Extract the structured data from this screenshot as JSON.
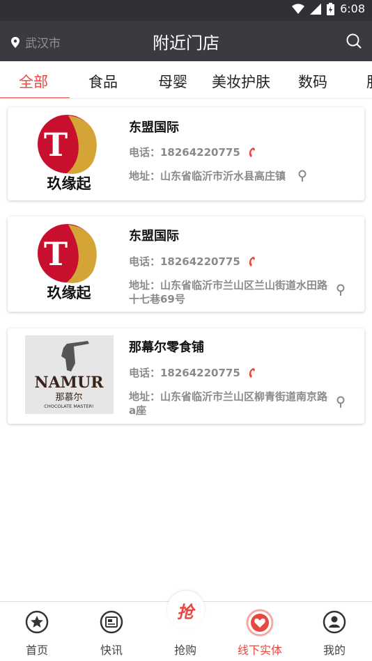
{
  "status": {
    "time": "6:08"
  },
  "header": {
    "location": "武汉市",
    "title": "附近门店"
  },
  "tabs": [
    {
      "label": "全部",
      "active": true
    },
    {
      "label": "食品"
    },
    {
      "label": "母婴"
    },
    {
      "label": "美妆护肤"
    },
    {
      "label": "数码"
    },
    {
      "label": "服"
    }
  ],
  "stores": [
    {
      "logo_text": "玖缘起",
      "logo_letter": "T",
      "name": "东盟国际",
      "phone": "电话：18264220775",
      "address": "地址：山东省临沂市沂水县高庄镇"
    },
    {
      "logo_text": "玖缘起",
      "logo_letter": "T",
      "name": "东盟国际",
      "phone": "电话：18264220775",
      "address": "地址：山东省临沂市兰山区兰山街道水田路十七巷69号"
    },
    {
      "logo_text": "NAMUR",
      "logo_sub": "那慕尔",
      "logo_tag": "CHOCOLATE MASTER!",
      "name": "那幕尔零食铺",
      "phone": "电话：18264220775",
      "address": "地址：山东省临沂市兰山区柳青街道南京路a座"
    }
  ],
  "bottom_nav": [
    {
      "label": "首页",
      "icon": "star-icon"
    },
    {
      "label": "快讯",
      "icon": "news-icon"
    },
    {
      "label": "抢购",
      "icon": "grab-icon",
      "icon_text": "抢"
    },
    {
      "label": "线下实体",
      "icon": "heart-store-icon",
      "active": true
    },
    {
      "label": "我的",
      "icon": "user-icon"
    }
  ],
  "colors": {
    "accent": "#e8473d",
    "header": "#3a3b41",
    "statusbar": "#2f3137"
  }
}
